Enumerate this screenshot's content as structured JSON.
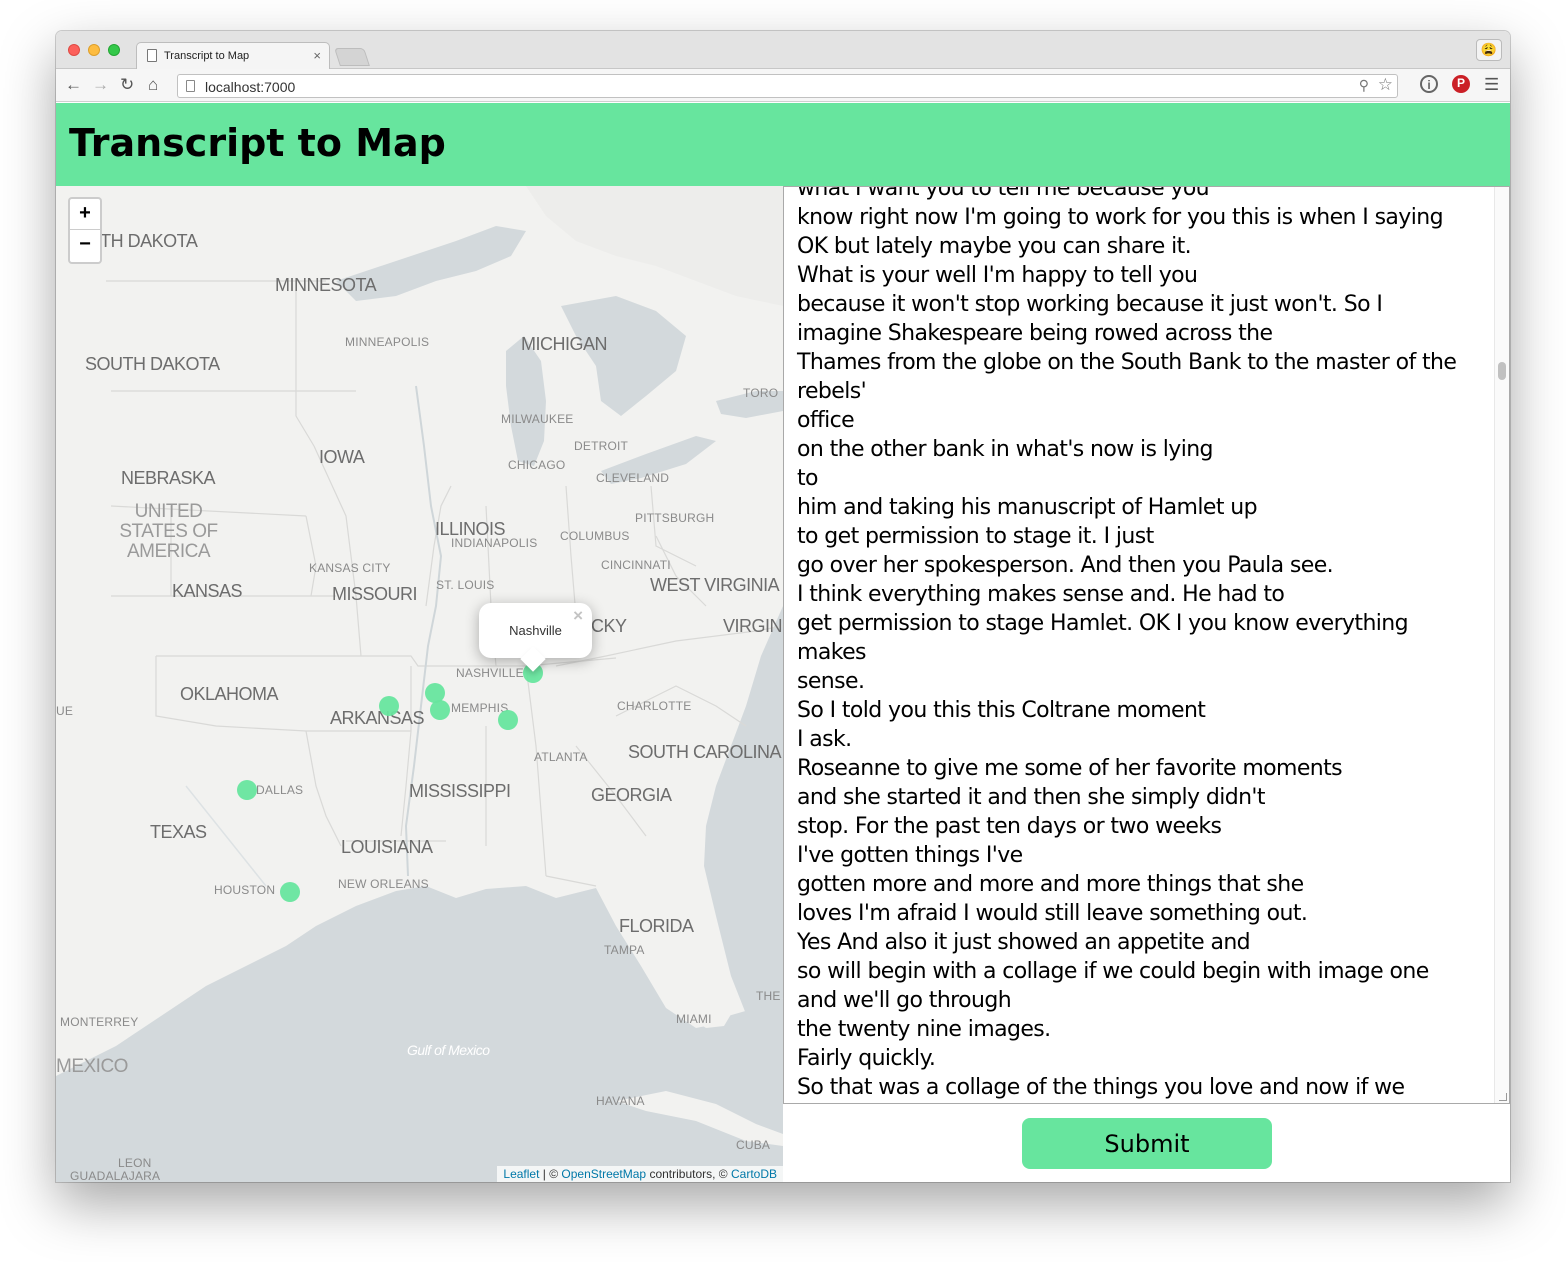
{
  "browser": {
    "tab_title": "Transcript to Map",
    "tab_close": "×",
    "url": "localhost:7000",
    "profile_icon": "😩",
    "icons": [
      "back-arrow-icon",
      "forward-arrow-icon",
      "reload-icon",
      "home-icon",
      "page-icon",
      "zoom-icon",
      "star-icon",
      "info-icon",
      "pinterest-icon",
      "menu-icon"
    ]
  },
  "header": {
    "title": "Transcript to Map"
  },
  "map": {
    "zoom_in": "+",
    "zoom_out": "−",
    "states": [
      "RTH DAKOTA",
      "MINNESOTA",
      "SOUTH DAKOTA",
      "MICHIGAN",
      "IOWA",
      "NEBRASKA",
      "ILLINOIS",
      "KANSAS",
      "MISSOURI",
      "WEST VIRGINIA",
      "VIRGINI",
      "CKY",
      "OKLAHOMA",
      "ARKANSAS",
      "SOUTH CAROLINA",
      "MISSISSIPPI",
      "GEORGIA",
      "TEXAS",
      "LOUISIANA",
      "FLORIDA",
      "UE"
    ],
    "country": "UNITED STATES OF AMERICA",
    "country2": "MEXICO",
    "cities": [
      "MINNEAPOLIS",
      "MILWAUKEE",
      "DETROIT",
      "CHICAGO",
      "CLEVELAND",
      "TORO",
      "PITTSBURGH",
      "INDIANAPOLIS",
      "COLUMBUS",
      "KANSAS CITY",
      "CINCINNATI",
      "ST. LOUIS",
      "NASHVILLE",
      "CHARLOTTE",
      "MEMPHIS",
      "ATLANTA",
      "DALLAS",
      "HOUSTON",
      "NEW ORLEANS",
      "TAMPA",
      "THE",
      "MIAMI",
      "MONTERREY",
      "HAVANA",
      "CUBA",
      "LEON",
      "GUADALAJARA"
    ],
    "water": "Gulf of Mexico",
    "popup": {
      "text": "Nashville",
      "close": "×"
    },
    "markers": [
      "Nashville",
      "marker-2",
      "marker-3",
      "marker-4",
      "marker-5",
      "marker-6",
      "marker-7"
    ],
    "attribution": {
      "leaflet": "Leaflet",
      "sep1": " | © ",
      "osm": "OpenStreetMap",
      "mid": " contributors, © ",
      "cartodb": "CartoDB"
    },
    "colors": {
      "marker": "#67e59e",
      "land": "#f2f2f0",
      "water": "#d4dadc",
      "header": "#67e59e"
    }
  },
  "transcript": {
    "text": "what I want you to tell me because you\nknow right now I'm going to work for you this is when I saying\nOK but lately maybe you can share it.\nWhat is your well I'm happy to tell you\nbecause it won't stop working because it just won't. So I\nimagine Shakespeare being rowed across the\nThames from the globe on the South Bank to the master of the\nrebels'\noffice\non the other bank in what's now is lying\nto\nhim and taking his manuscript of Hamlet up\nto get permission to stage it. I just\ngo over her spokesperson. And then you Paula see.\nI think everything makes sense and. He had to\nget permission to stage Hamlet. OK I you know everything\nmakes\nsense.\nSo I told you this this Coltrane moment\nI ask.\nRoseanne to give me some of her favorite moments\nand she started it and then she simply didn't\nstop. For the past ten days or two weeks\nI've gotten things I've\ngotten more and more and more things that she\nloves I'm afraid I would still leave something out.\nYes And also it just showed an appetite and\nso will begin with a collage if we could begin with image one\nand we'll go through\nthe twenty nine images.\nFairly quickly.\nSo that was a collage of the things you love and now if we"
  },
  "submit": {
    "label": "Submit"
  }
}
